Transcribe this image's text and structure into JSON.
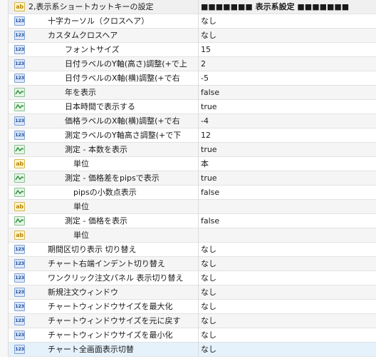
{
  "rows": [
    {
      "icon": "ab",
      "name": "2,表示系ショートカットキーの設定",
      "value": "■■■■■■■ 表示系設定 ■■■■■■■",
      "indent": 0,
      "kind": "header"
    },
    {
      "icon": "123",
      "name": "十字カーソル（クロスヘア）",
      "value": "なし",
      "indent": 1
    },
    {
      "icon": "123",
      "name": "カスタムクロスヘア",
      "value": "なし",
      "indent": 1
    },
    {
      "icon": "123",
      "name": "フォントサイズ",
      "value": "15",
      "indent": 2
    },
    {
      "icon": "123",
      "name": "日付ラベルのY軸(高さ)調整(+で上",
      "value": "2",
      "indent": 2
    },
    {
      "icon": "123",
      "name": "日付ラベルのX軸(横)調整(+で右",
      "value": "-5",
      "indent": 2
    },
    {
      "icon": "bool",
      "name": "年を表示",
      "value": "false",
      "indent": 2
    },
    {
      "icon": "bool",
      "name": "日本時間で表示する",
      "value": "true",
      "indent": 2
    },
    {
      "icon": "123",
      "name": "価格ラベルのX軸(横)調整(+で右",
      "value": "-4",
      "indent": 2
    },
    {
      "icon": "123",
      "name": "測定ラベルのY軸高さ調整(+で下",
      "value": "12",
      "indent": 2
    },
    {
      "icon": "bool",
      "name": "測定 - 本数を表示",
      "value": "true",
      "indent": 2
    },
    {
      "icon": "ab",
      "name": "単位",
      "value": "本",
      "indent": 3
    },
    {
      "icon": "bool",
      "name": "測定 - 価格差をpipsで表示",
      "value": "true",
      "indent": 2
    },
    {
      "icon": "bool",
      "name": "pipsの小数点表示",
      "value": "false",
      "indent": 3
    },
    {
      "icon": "ab",
      "name": "単位",
      "value": "",
      "indent": 3
    },
    {
      "icon": "bool",
      "name": "測定 - 価格を表示",
      "value": "false",
      "indent": 2
    },
    {
      "icon": "ab",
      "name": "単位",
      "value": "",
      "indent": 3
    },
    {
      "icon": "123",
      "name": "期間区切り表示 切り替え",
      "value": "なし",
      "indent": 1
    },
    {
      "icon": "123",
      "name": "チャート右端インデント切り替え",
      "value": "なし",
      "indent": 1
    },
    {
      "icon": "123",
      "name": "ワンクリック注文パネル 表示切り替え",
      "value": "なし",
      "indent": 1
    },
    {
      "icon": "123",
      "name": "新規注文ウィンドウ",
      "value": "なし",
      "indent": 1
    },
    {
      "icon": "123",
      "name": "チャートウィンドウサイズを最大化",
      "value": "なし",
      "indent": 1
    },
    {
      "icon": "123",
      "name": "チャートウィンドウサイズを元に戻す",
      "value": "なし",
      "indent": 1
    },
    {
      "icon": "123",
      "name": "チャートウィンドウサイズを最小化",
      "value": "なし",
      "indent": 1
    },
    {
      "icon": "123",
      "name": "チャート全画面表示切替",
      "value": "なし",
      "indent": 1,
      "kind": "selected"
    }
  ],
  "icons": {
    "ab": {
      "name": "string-type-icon",
      "label": "ab",
      "color": "#b8860b",
      "bg": "#fff6c8"
    },
    "123": {
      "name": "integer-type-icon",
      "label": "123",
      "color": "#1f4e9a",
      "bg": "#dbe7fb"
    },
    "bool": {
      "name": "boolean-type-icon",
      "label": "",
      "color": "#2e8b3a",
      "bg": "#e2f5e4"
    }
  }
}
